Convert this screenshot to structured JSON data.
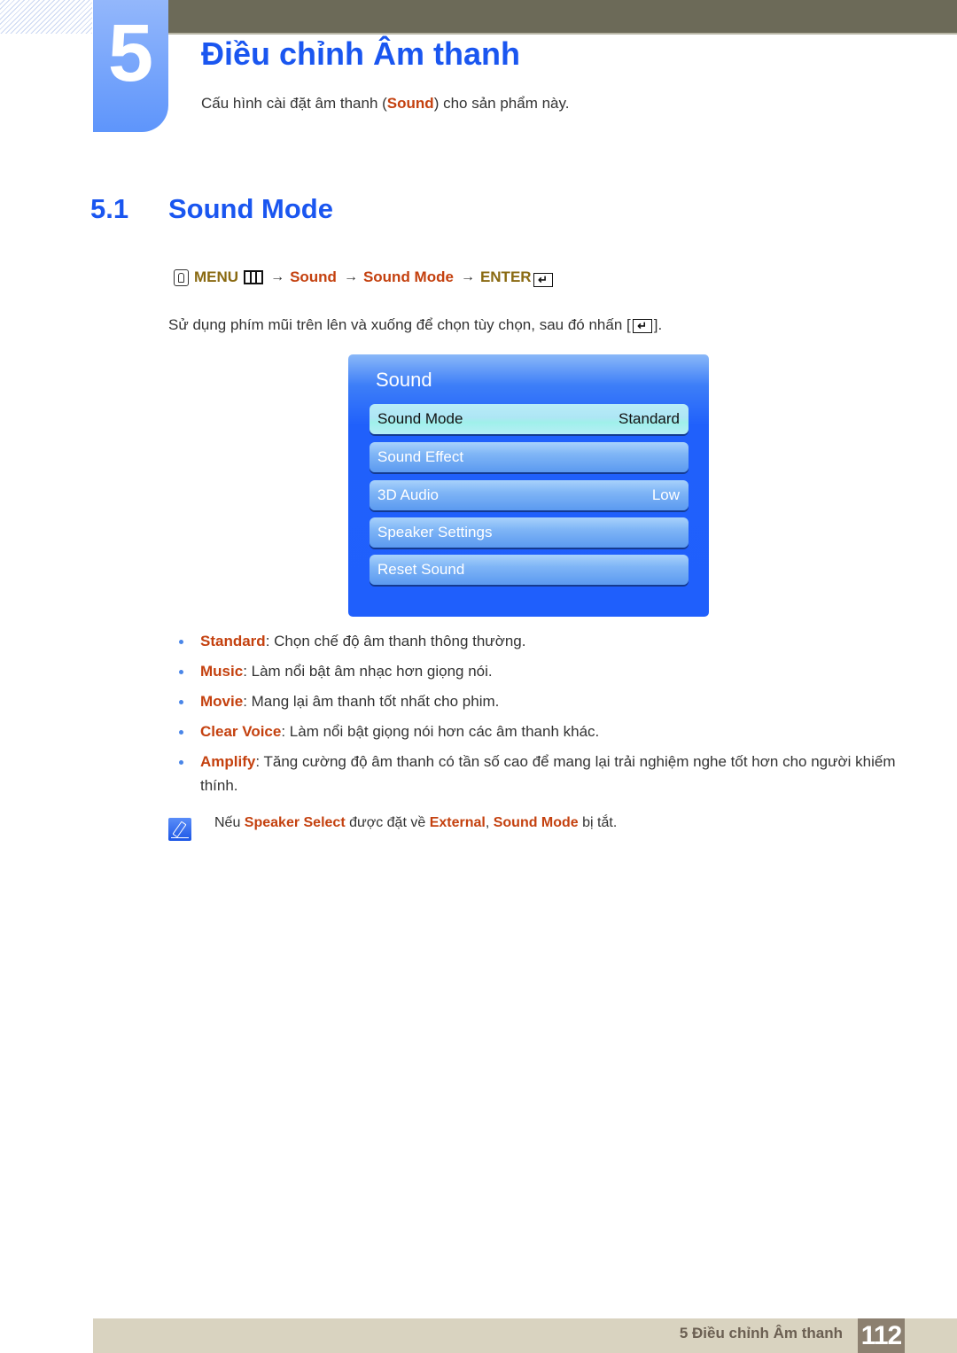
{
  "chapter": {
    "number": "5",
    "title": "Điều chỉnh Âm thanh",
    "subtitle_pre": "Cấu hình cài đặt âm thanh (",
    "subtitle_highlight": "Sound",
    "subtitle_post": ") cho sản phẩm này."
  },
  "section": {
    "number": "5.1",
    "title": "Sound Mode"
  },
  "menu_path": {
    "menu_label": "MENU",
    "arrow": "→",
    "step1": "Sound",
    "step2": "Sound Mode",
    "enter_label": "ENTER",
    "enter_glyph": "↵"
  },
  "instruction": {
    "text": "Sử dụng phím mũi trên lên và xuống để chọn tùy chọn, sau đó nhấn [",
    "close": "]."
  },
  "osd": {
    "title": "Sound",
    "items": [
      {
        "label": "Sound Mode",
        "value": "Standard",
        "selected": true
      },
      {
        "label": "Sound Effect",
        "value": ""
      },
      {
        "label": "3D Audio",
        "value": "Low"
      },
      {
        "label": "Speaker Settings",
        "value": ""
      },
      {
        "label": "Reset Sound",
        "value": ""
      }
    ]
  },
  "options": [
    {
      "term": "Standard",
      "desc": ": Chọn chế độ âm thanh thông thường."
    },
    {
      "term": "Music",
      "desc": ": Làm nổi bật âm nhạc hơn giọng nói."
    },
    {
      "term": "Movie",
      "desc": ": Mang lại âm thanh tốt nhất cho phim."
    },
    {
      "term": "Clear Voice",
      "desc": ": Làm nổi bật giọng nói hơn các âm thanh khác."
    },
    {
      "term": "Amplify",
      "desc": ": Tăng cường độ âm thanh có tần số cao để mang lại trải nghiệm nghe tốt hơn cho người khiếm thính."
    }
  ],
  "note": {
    "pre": "Nếu ",
    "term1": "Speaker Select",
    "mid1": " được đặt về ",
    "term2": "External",
    "mid2": ", ",
    "term3": "Sound Mode",
    "post": " bị tắt."
  },
  "footer": {
    "chapter_label": "5 Điều chỉnh Âm thanh",
    "page_number": "112"
  }
}
